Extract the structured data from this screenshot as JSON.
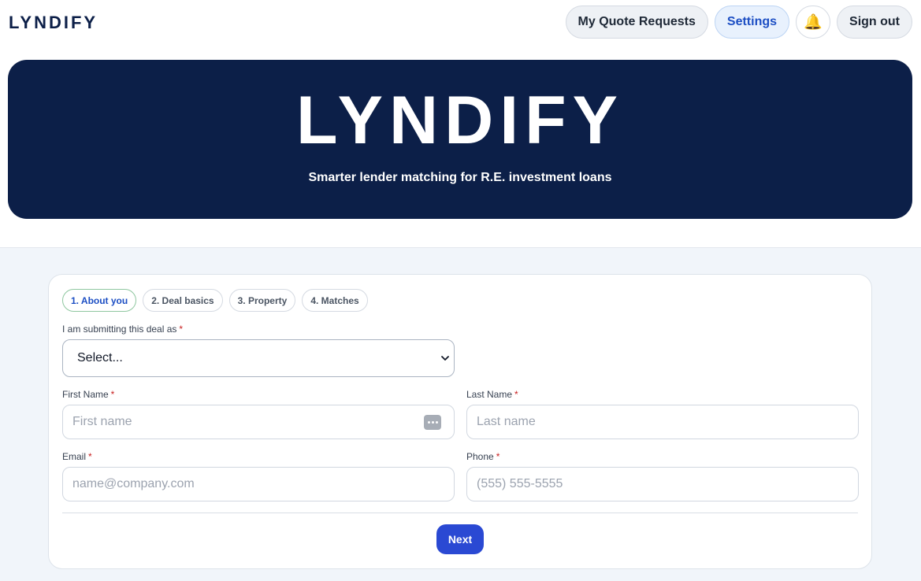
{
  "brand": "LYNDIFY",
  "nav": {
    "quote_requests": "My Quote Requests",
    "settings": "Settings",
    "bell_glyph": "🔔",
    "sign_out": "Sign out"
  },
  "hero": {
    "title": "LYNDIFY",
    "subtitle": "Smarter lender matching for R.E. investment loans"
  },
  "steps": [
    {
      "label": "1. About you",
      "active": true
    },
    {
      "label": "2. Deal basics",
      "active": false
    },
    {
      "label": "3. Property",
      "active": false
    },
    {
      "label": "4. Matches",
      "active": false
    }
  ],
  "form": {
    "role_label": "I am submitting this deal as",
    "role_value": "Select...",
    "first_name_label": "First Name",
    "first_name_placeholder": "First name",
    "last_name_label": "Last Name",
    "last_name_placeholder": "Last name",
    "email_label": "Email",
    "email_placeholder": "name@company.com",
    "phone_label": "Phone",
    "phone_placeholder": "(555) 555-5555",
    "required_mark": "*",
    "next_label": "Next"
  },
  "colors": {
    "brand_navy": "#0c1f48",
    "accent_blue": "#2a49d3",
    "required_red": "#c81e1e"
  }
}
